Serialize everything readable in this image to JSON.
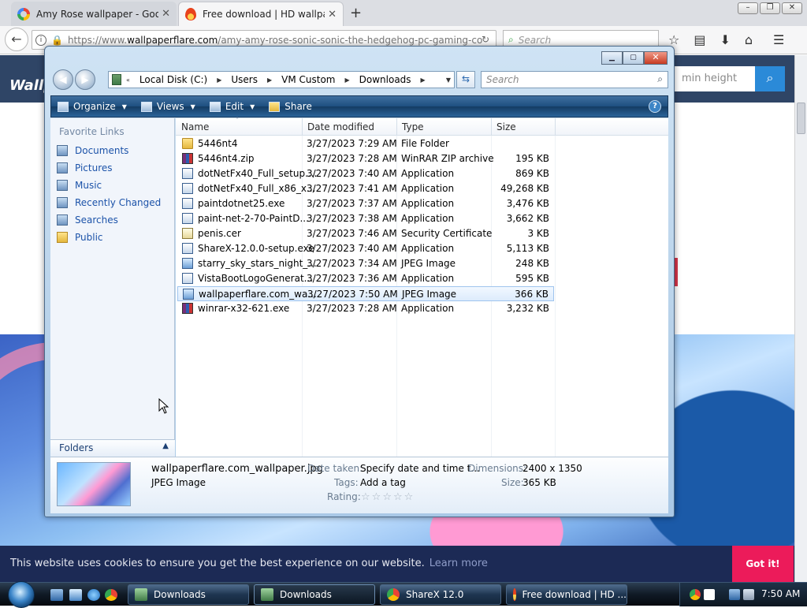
{
  "browser": {
    "tabs": [
      {
        "title": "Amy Rose wallpaper - Goog",
        "icon": "google-icon"
      },
      {
        "title": "Free download | HD wallpap",
        "icon": "flame-icon"
      }
    ],
    "url": {
      "protocol": "https://www.",
      "host": "wallpaperflare.com",
      "path": "/amy-amy-rose-sonic-sonic-the-hedgehog-pc-gaming-co"
    },
    "search_placeholder": "Search"
  },
  "site": {
    "logo": "Wallp",
    "search_placeholder": "min height",
    "cookie_text": "This website uses cookies to ensure you get the best experience on our website.",
    "cookie_link": "Learn more",
    "cookie_button": "Got it!"
  },
  "explorer": {
    "breadcrumbs": [
      "Local Disk (C:)",
      "Users",
      "VM Custom",
      "Downloads"
    ],
    "search_placeholder": "Search",
    "commands": [
      {
        "label": "Organize",
        "has_dropdown": true
      },
      {
        "label": "Views",
        "has_dropdown": true
      },
      {
        "label": "Edit",
        "has_dropdown": true
      },
      {
        "label": "Share",
        "has_dropdown": false
      }
    ],
    "favorites_title": "Favorite Links",
    "favorites": [
      "Documents",
      "Pictures",
      "Music",
      "Recently Changed",
      "Searches",
      "Public"
    ],
    "folders_label": "Folders",
    "columns": {
      "name": "Name",
      "date": "Date modified",
      "type": "Type",
      "size": "Size"
    },
    "files": [
      {
        "name": "5446nt4",
        "date": "3/27/2023 7:29 AM",
        "type": "File Folder",
        "size": "",
        "icon": "folder"
      },
      {
        "name": "5446nt4.zip",
        "date": "3/27/2023 7:28 AM",
        "type": "WinRAR ZIP archive",
        "size": "195 KB",
        "icon": "zip"
      },
      {
        "name": "dotNetFx40_Full_setup....",
        "date": "3/27/2023 7:40 AM",
        "type": "Application",
        "size": "869 KB",
        "icon": "app"
      },
      {
        "name": "dotNetFx40_Full_x86_x...",
        "date": "3/27/2023 7:41 AM",
        "type": "Application",
        "size": "49,268 KB",
        "icon": "app"
      },
      {
        "name": "paintdotnet25.exe",
        "date": "3/27/2023 7:37 AM",
        "type": "Application",
        "size": "3,476 KB",
        "icon": "app"
      },
      {
        "name": "paint-net-2-70-PaintD...",
        "date": "3/27/2023 7:38 AM",
        "type": "Application",
        "size": "3,662 KB",
        "icon": "app"
      },
      {
        "name": "penis.cer",
        "date": "3/27/2023 7:46 AM",
        "type": "Security Certificate",
        "size": "3 KB",
        "icon": "cert"
      },
      {
        "name": "ShareX-12.0.0-setup.exe",
        "date": "3/27/2023 7:40 AM",
        "type": "Application",
        "size": "5,113 KB",
        "icon": "app"
      },
      {
        "name": "starry_sky_stars_night_...",
        "date": "3/27/2023 7:34 AM",
        "type": "JPEG Image",
        "size": "248 KB",
        "icon": "jpg"
      },
      {
        "name": "VistaBootLogoGenerat...",
        "date": "3/27/2023 7:36 AM",
        "type": "Application",
        "size": "595 KB",
        "icon": "app"
      },
      {
        "name": "wallpaperflare.com_wa...",
        "date": "3/27/2023 7:50 AM",
        "type": "JPEG Image",
        "size": "366 KB",
        "icon": "jpg",
        "selected": true
      },
      {
        "name": "winrar-x32-621.exe",
        "date": "3/27/2023 7:28 AM",
        "type": "Application",
        "size": "3,232 KB",
        "icon": "zip"
      }
    ],
    "details": {
      "filename": "wallpaperflare.com_wallpaper.jpg",
      "filetype": "JPEG Image",
      "date_taken_label": "Date taken:",
      "date_taken_value": "Specify date and time t...",
      "tags_label": "Tags:",
      "tags_value": "Add a tag",
      "rating_label": "Rating:",
      "rating_stars": 0,
      "dimensions_label": "Dimensions:",
      "dimensions_value": "2400 x 1350",
      "size_label": "Size:",
      "size_value": "365 KB"
    }
  },
  "taskbar": {
    "buttons": [
      "Downloads",
      "Downloads",
      "ShareX 12.0",
      "Free download | HD ..."
    ],
    "clock": "7:50 AM"
  }
}
